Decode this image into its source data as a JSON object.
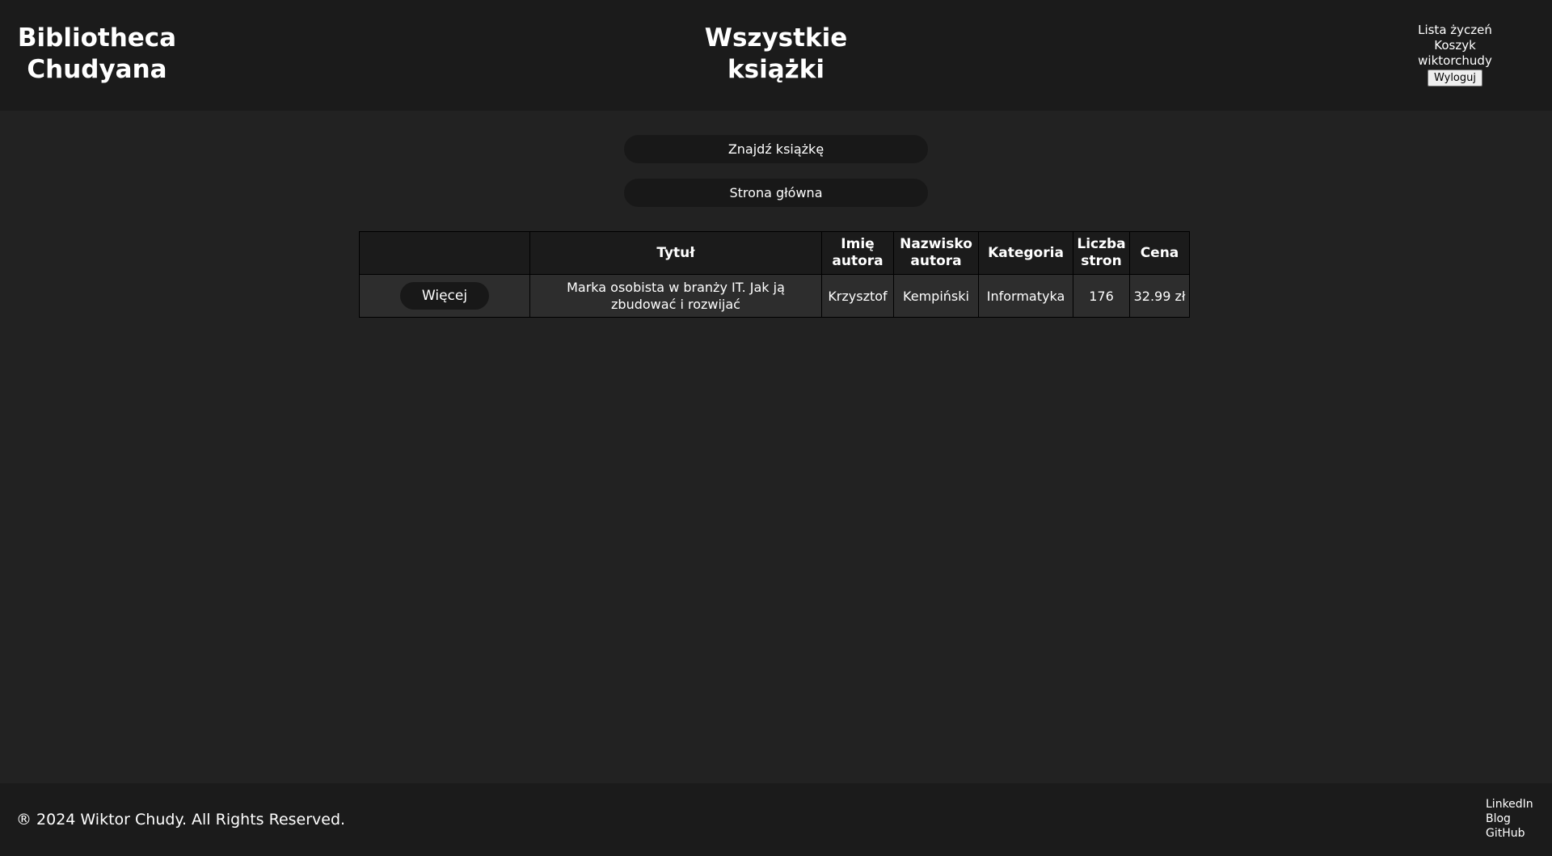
{
  "header": {
    "brand_line1": "Bibliotheca",
    "brand_line2": "Chudyana",
    "title_line1": "Wszystkie",
    "title_line2": "książki",
    "user_nav": {
      "wishlist": "Lista życzeń",
      "cart": "Koszyk",
      "username": "wiktorchudy",
      "logout": "Wyloguj"
    }
  },
  "actions": {
    "find_book": "Znajdź książkę",
    "home": "Strona główna"
  },
  "table": {
    "headers": {
      "title": "Tytuł",
      "author_first_line1": "Imię",
      "author_first_line2": "autora",
      "author_last_line1": "Nazwisko",
      "author_last_line2": "autora",
      "category": "Kategoria",
      "pages_line1": "Liczba",
      "pages_line2": "stron",
      "price": "Cena"
    },
    "rows": [
      {
        "more": "Więcej",
        "title_line1": "Marka osobista w branży IT. Jak ją",
        "title_line2": "zbudować i rozwijać",
        "author_first": "Krzysztof",
        "author_last": "Kempiński",
        "category": "Informatyka",
        "pages": "176",
        "price": "32.99 zł"
      }
    ]
  },
  "footer": {
    "copyright": "® 2024 Wiktor Chudy. All Rights Reserved.",
    "links": {
      "linkedin": "LinkedIn",
      "blog": "Blog",
      "github": "GitHub"
    }
  },
  "colors": {
    "background": "#222222",
    "header_footer": "#1b1b1b",
    "button": "#181818",
    "cell": "#2d2d2d"
  }
}
